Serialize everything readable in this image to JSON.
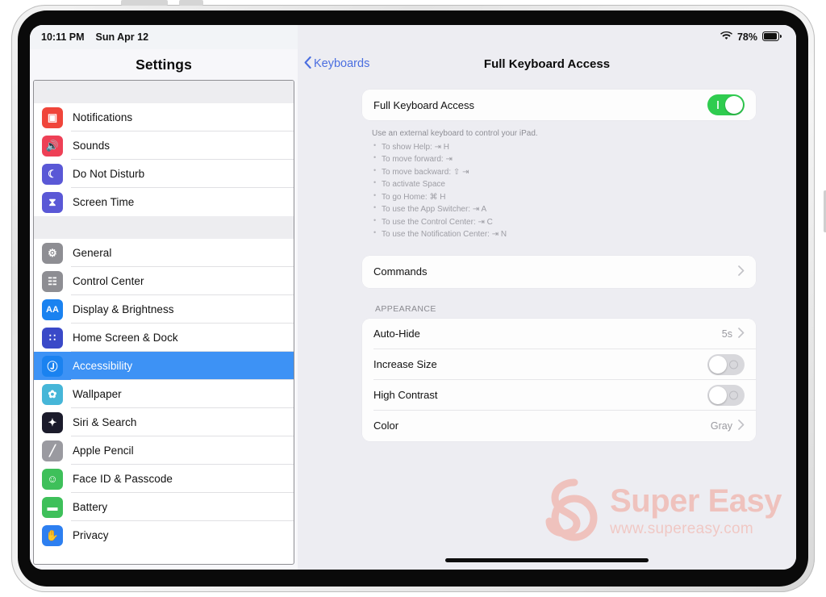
{
  "status_bar": {
    "time": "10:11 PM",
    "date": "Sun Apr 12",
    "wifi_icon": "wifi-icon",
    "battery_percent": "78%",
    "battery_icon": "battery-icon"
  },
  "sidebar": {
    "title": "Settings",
    "groups": [
      {
        "items": [
          {
            "label": "Notifications",
            "icon": "notifications-icon",
            "icon_color": "#f0453a",
            "glyph": "▣",
            "selected": false
          },
          {
            "label": "Sounds",
            "icon": "sounds-icon",
            "icon_color": "#ee4056",
            "glyph": "🔊",
            "selected": false
          },
          {
            "label": "Do Not Disturb",
            "icon": "do-not-disturb-icon",
            "icon_color": "#5a58d6",
            "glyph": "☾",
            "selected": false
          },
          {
            "label": "Screen Time",
            "icon": "screen-time-icon",
            "icon_color": "#5a58d6",
            "glyph": "⧗",
            "selected": false
          }
        ]
      },
      {
        "items": [
          {
            "label": "General",
            "icon": "general-gear-icon",
            "icon_color": "#8e8e93",
            "glyph": "⚙",
            "selected": false
          },
          {
            "label": "Control Center",
            "icon": "control-center-icon",
            "icon_color": "#8e8e93",
            "glyph": "☷",
            "selected": false
          },
          {
            "label": "Display & Brightness",
            "icon": "display-brightness-icon",
            "icon_color": "#1a82f0",
            "glyph": "AA",
            "selected": false
          },
          {
            "label": "Home Screen & Dock",
            "icon": "home-screen-dock-icon",
            "icon_color": "#3a49c8",
            "glyph": "∷",
            "selected": false
          },
          {
            "label": "Accessibility",
            "icon": "accessibility-icon",
            "icon_color": "#1a82f0",
            "glyph": "Ⓙ",
            "selected": true
          },
          {
            "label": "Wallpaper",
            "icon": "wallpaper-icon",
            "icon_color": "#46b6d8",
            "glyph": "✿",
            "selected": false
          },
          {
            "label": "Siri & Search",
            "icon": "siri-search-icon",
            "icon_color": "#1b1b2b",
            "glyph": "✦",
            "selected": false
          },
          {
            "label": "Apple Pencil",
            "icon": "apple-pencil-icon",
            "icon_color": "#9a9aa0",
            "glyph": "╱",
            "selected": false
          },
          {
            "label": "Face ID & Passcode",
            "icon": "face-id-icon",
            "icon_color": "#3ec05a",
            "glyph": "☺",
            "selected": false
          },
          {
            "label": "Battery",
            "icon": "battery-settings-icon",
            "icon_color": "#3ec05a",
            "glyph": "▬",
            "selected": false
          },
          {
            "label": "Privacy",
            "icon": "privacy-hand-icon",
            "icon_color": "#2d7ff0",
            "glyph": "✋",
            "selected": false
          }
        ]
      }
    ]
  },
  "detail": {
    "back_label": "Keyboards",
    "back_icon": "chevron-left-icon",
    "title": "Full Keyboard Access",
    "main_toggle": {
      "label": "Full Keyboard Access",
      "state": "on"
    },
    "help": {
      "lead": "Use an external keyboard to control your iPad.",
      "items": [
        "To show Help: ⇥ H",
        "To move forward: ⇥",
        "To move backward: ⇧ ⇥",
        "To activate  Space",
        "To go Home: ⌘ H",
        "To use the App Switcher: ⇥ A",
        "To use the Control Center: ⇥ C",
        "To use the Notification Center: ⇥ N"
      ]
    },
    "commands": {
      "label": "Commands",
      "chevron": "chevron-right-icon"
    },
    "appearance": {
      "header": "APPEARANCE",
      "rows": [
        {
          "label": "Auto-Hide",
          "type": "value",
          "value": "5s",
          "chevron": "chevron-right-icon"
        },
        {
          "label": "Increase Size",
          "type": "toggle",
          "state": "off"
        },
        {
          "label": "High Contrast",
          "type": "toggle",
          "state": "off"
        },
        {
          "label": "Color",
          "type": "value",
          "value": "Gray",
          "chevron": "chevron-right-icon"
        }
      ]
    }
  },
  "watermark": {
    "name": "Super Easy",
    "url": "www.supereasy.com",
    "color": "#f2a093"
  }
}
